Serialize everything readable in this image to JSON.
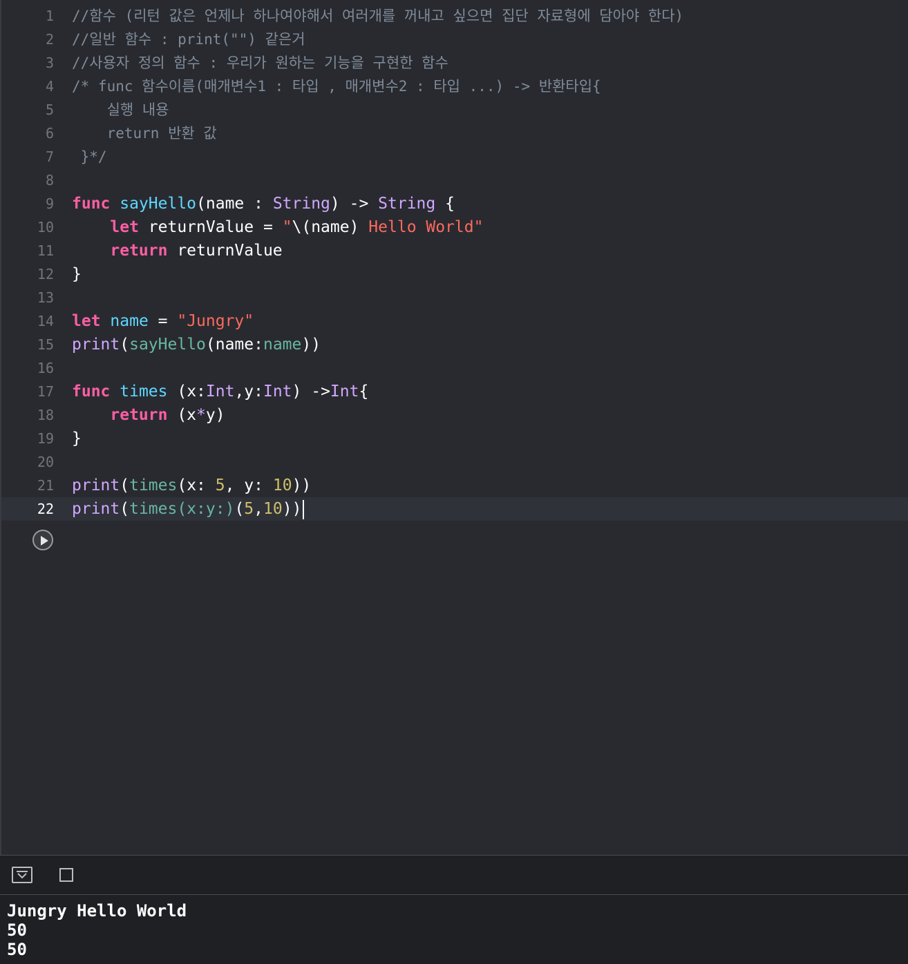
{
  "editor": {
    "current_line": "22",
    "lines": [
      {
        "num": "1",
        "tokens": [
          {
            "t": "comment",
            "v": "//함수 (리턴 값은 언제나 하나여야해서 여러개를 꺼내고 싶으면 집단 자료형에 담아야 한다)"
          }
        ]
      },
      {
        "num": "2",
        "tokens": [
          {
            "t": "comment",
            "v": "//일반 함수 : print(\"\") 같은거"
          }
        ]
      },
      {
        "num": "3",
        "tokens": [
          {
            "t": "comment",
            "v": "//사용자 정의 함수 : 우리가 원하는 기능을 구현한 함수"
          }
        ]
      },
      {
        "num": "4",
        "tokens": [
          {
            "t": "comment",
            "v": "/* func 함수이름(매개변수1 : 타입 , 매개변수2 : 타입 ...) -> 반환타입{"
          }
        ]
      },
      {
        "num": "5",
        "tokens": [
          {
            "t": "comment",
            "v": "    실행 내용"
          }
        ]
      },
      {
        "num": "6",
        "tokens": [
          {
            "t": "comment",
            "v": "    return 반환 값"
          }
        ]
      },
      {
        "num": "7",
        "tokens": [
          {
            "t": "comment",
            "v": " }*/"
          }
        ]
      },
      {
        "num": "8",
        "tokens": []
      },
      {
        "num": "9",
        "tokens": [
          {
            "t": "keyword",
            "v": "func"
          },
          {
            "t": "plain",
            "v": " "
          },
          {
            "t": "funcdecl",
            "v": "sayHello"
          },
          {
            "t": "plain",
            "v": "(name : "
          },
          {
            "t": "type",
            "v": "String"
          },
          {
            "t": "plain",
            "v": ") -> "
          },
          {
            "t": "type",
            "v": "String"
          },
          {
            "t": "plain",
            "v": " {"
          }
        ]
      },
      {
        "num": "10",
        "tokens": [
          {
            "t": "plain",
            "v": "    "
          },
          {
            "t": "keyword",
            "v": "let"
          },
          {
            "t": "plain",
            "v": " returnValue = "
          },
          {
            "t": "string",
            "v": "\""
          },
          {
            "t": "interp",
            "v": "\\(name)"
          },
          {
            "t": "string",
            "v": " Hello World\""
          }
        ]
      },
      {
        "num": "11",
        "tokens": [
          {
            "t": "plain",
            "v": "    "
          },
          {
            "t": "keyword",
            "v": "return"
          },
          {
            "t": "plain",
            "v": " returnValue"
          }
        ]
      },
      {
        "num": "12",
        "tokens": [
          {
            "t": "plain",
            "v": "}"
          }
        ]
      },
      {
        "num": "13",
        "tokens": []
      },
      {
        "num": "14",
        "tokens": [
          {
            "t": "keyword",
            "v": "let"
          },
          {
            "t": "plain",
            "v": " "
          },
          {
            "t": "funcdecl",
            "v": "name"
          },
          {
            "t": "plain",
            "v": " = "
          },
          {
            "t": "string",
            "v": "\"Jungry\""
          }
        ]
      },
      {
        "num": "15",
        "tokens": [
          {
            "t": "type",
            "v": "print"
          },
          {
            "t": "plain",
            "v": "("
          },
          {
            "t": "funcname",
            "v": "sayHello"
          },
          {
            "t": "plain",
            "v": "(name:"
          },
          {
            "t": "funcname",
            "v": "name"
          },
          {
            "t": "plain",
            "v": "))"
          }
        ]
      },
      {
        "num": "16",
        "tokens": []
      },
      {
        "num": "17",
        "tokens": [
          {
            "t": "keyword",
            "v": "func"
          },
          {
            "t": "plain",
            "v": " "
          },
          {
            "t": "funcdecl",
            "v": "times"
          },
          {
            "t": "plain",
            "v": " (x:"
          },
          {
            "t": "type",
            "v": "Int"
          },
          {
            "t": "plain",
            "v": ",y:"
          },
          {
            "t": "type",
            "v": "Int"
          },
          {
            "t": "plain",
            "v": ") ->"
          },
          {
            "t": "type",
            "v": "Int"
          },
          {
            "t": "plain",
            "v": "{"
          }
        ]
      },
      {
        "num": "18",
        "tokens": [
          {
            "t": "plain",
            "v": "    "
          },
          {
            "t": "keyword",
            "v": "return"
          },
          {
            "t": "plain",
            "v": " (x"
          },
          {
            "t": "type",
            "v": "*"
          },
          {
            "t": "plain",
            "v": "y)"
          }
        ]
      },
      {
        "num": "19",
        "tokens": [
          {
            "t": "plain",
            "v": "}"
          }
        ]
      },
      {
        "num": "20",
        "tokens": []
      },
      {
        "num": "21",
        "tokens": [
          {
            "t": "type",
            "v": "print"
          },
          {
            "t": "plain",
            "v": "("
          },
          {
            "t": "funcname",
            "v": "times"
          },
          {
            "t": "plain",
            "v": "(x: "
          },
          {
            "t": "number",
            "v": "5"
          },
          {
            "t": "plain",
            "v": ", y: "
          },
          {
            "t": "number",
            "v": "10"
          },
          {
            "t": "plain",
            "v": "))"
          }
        ]
      },
      {
        "num": "22",
        "tokens": [
          {
            "t": "type",
            "v": "print"
          },
          {
            "t": "plain",
            "v": "("
          },
          {
            "t": "funcname",
            "v": "times(x:y:)"
          },
          {
            "t": "plain",
            "v": "("
          },
          {
            "t": "number",
            "v": "5"
          },
          {
            "t": "plain",
            "v": ","
          },
          {
            "t": "number",
            "v": "10"
          },
          {
            "t": "plain",
            "v": "))"
          }
        ]
      }
    ]
  },
  "run_button": {
    "icon": "play-icon"
  },
  "debug_bar": {
    "hide_icon": "chevron-down-icon",
    "console_icon": "square-icon"
  },
  "console": {
    "output": [
      "Jungry Hello World",
      "50",
      "50"
    ]
  },
  "colors": {
    "background": "#292a30",
    "keyword": "#fc5fa3",
    "comment": "#7f8c98",
    "type": "#d0a8ff",
    "string": "#fc6a5d",
    "number": "#d0bf69",
    "funcdecl": "#5dd8ff",
    "funcname": "#67b7a4"
  }
}
